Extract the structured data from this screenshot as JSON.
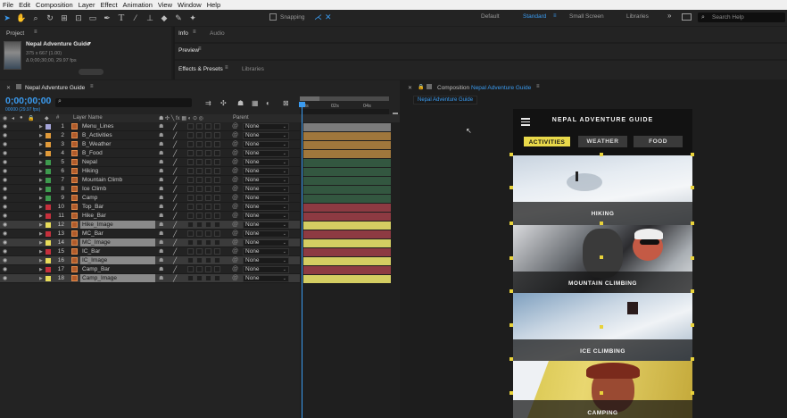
{
  "menu": [
    "File",
    "Edit",
    "Composition",
    "Layer",
    "Effect",
    "Animation",
    "View",
    "Window",
    "Help"
  ],
  "toolbar": {
    "snapping": "Snapping",
    "workspaces": [
      "Default",
      "Standard",
      "Small Screen",
      "Libraries"
    ],
    "active_workspace": "Standard",
    "search_placeholder": "Search Help"
  },
  "project": {
    "tab": "Project",
    "item_name": "Nepal Adventure Guide",
    "item_dims": "375 x 667 (1.00)",
    "item_duration": "Δ 0;00;30;00, 29.97 fps"
  },
  "right_panels": {
    "info": "Info",
    "audio": "Audio",
    "preview": "Preview",
    "effects": "Effects & Presets",
    "libraries": "Libraries"
  },
  "timeline": {
    "tab": "Nepal Adventure Guide",
    "timecode": "0;00;00;00",
    "fps": "00000 (29.97 fps)",
    "search_icon": "search-icon",
    "ruler": [
      "0s",
      "02s",
      "04s"
    ],
    "col_headers": {
      "num": "#",
      "layer_name": "Layer Name",
      "parent": "Parent"
    },
    "layers": [
      {
        "num": "1",
        "name": "Menu_Lines",
        "label_color": "#a4a4d8",
        "parent": "None",
        "bar_color": "#7c7c7c",
        "selected": false
      },
      {
        "num": "2",
        "name": "B_Activities",
        "label_color": "#e09a3a",
        "parent": "None",
        "bar_color": "#a0773c",
        "selected": false
      },
      {
        "num": "3",
        "name": "B_Weather",
        "label_color": "#e09a3a",
        "parent": "None",
        "bar_color": "#a0773c",
        "selected": false
      },
      {
        "num": "4",
        "name": "B_Food",
        "label_color": "#e09a3a",
        "parent": "None",
        "bar_color": "#a0773c",
        "selected": false
      },
      {
        "num": "5",
        "name": "Nepal",
        "label_color": "#3e9a4e",
        "parent": "None",
        "bar_color": "#335740",
        "selected": false
      },
      {
        "num": "6",
        "name": "Hiking",
        "label_color": "#3e9a4e",
        "parent": "None",
        "bar_color": "#335740",
        "selected": false
      },
      {
        "num": "7",
        "name": "Mountain Climb",
        "label_color": "#3e9a4e",
        "parent": "None",
        "bar_color": "#335740",
        "selected": false
      },
      {
        "num": "8",
        "name": "Ice Climb",
        "label_color": "#3e9a4e",
        "parent": "None",
        "bar_color": "#335740",
        "selected": false
      },
      {
        "num": "9",
        "name": "Camp",
        "label_color": "#3e9a4e",
        "parent": "None",
        "bar_color": "#335740",
        "selected": false
      },
      {
        "num": "10",
        "name": "Top_Bar",
        "label_color": "#c6303c",
        "parent": "None",
        "bar_color": "#8d3a42",
        "selected": false
      },
      {
        "num": "11",
        "name": "Hike_Bar",
        "label_color": "#c6303c",
        "parent": "None",
        "bar_color": "#8d3a42",
        "selected": false
      },
      {
        "num": "12",
        "name": "Hike_Image",
        "label_color": "#e8dc5a",
        "parent": "None",
        "bar_color": "#d4cd62",
        "selected": true
      },
      {
        "num": "13",
        "name": "MC_Bar",
        "label_color": "#c6303c",
        "parent": "None",
        "bar_color": "#8d3a42",
        "selected": false
      },
      {
        "num": "14",
        "name": "MC_Image",
        "label_color": "#e8dc5a",
        "parent": "None",
        "bar_color": "#d4cd62",
        "selected": true
      },
      {
        "num": "15",
        "name": "IC_Bar",
        "label_color": "#c6303c",
        "parent": "None",
        "bar_color": "#8d3a42",
        "selected": false
      },
      {
        "num": "16",
        "name": "IC_Image",
        "label_color": "#e8dc5a",
        "parent": "None",
        "bar_color": "#d4cd62",
        "selected": true
      },
      {
        "num": "17",
        "name": "Camp_Bar",
        "label_color": "#c6303c",
        "parent": "None",
        "bar_color": "#8d3a42",
        "selected": false
      },
      {
        "num": "18",
        "name": "Camp_Image",
        "label_color": "#e8dc5a",
        "parent": "None",
        "bar_color": "#d4cd62",
        "selected": true
      }
    ]
  },
  "composition": {
    "panel_prefix": "Composition",
    "name": "Nepal Adventure Guide",
    "tab": "Nepal Adventure Guide",
    "app_title": "NEPAL ADVENTURE GUIDE",
    "tabs": [
      {
        "label": "ACTIVITIES",
        "active": true
      },
      {
        "label": "WEATHER",
        "active": false
      },
      {
        "label": "FOOD",
        "active": false
      }
    ],
    "cards": [
      "HIKING",
      "MOUNTAIN CLIMBING",
      "ICE CLIMBING",
      "CAMPING"
    ],
    "accent": "#e9d94a"
  }
}
